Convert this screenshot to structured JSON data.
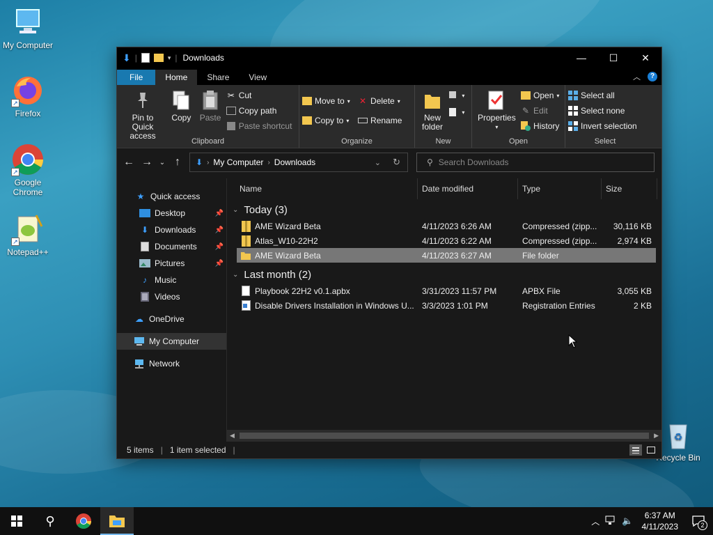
{
  "desktop": {
    "icons": [
      {
        "label": "My Computer",
        "icon": "computer-icon"
      },
      {
        "label": "Firefox",
        "icon": "firefox-icon"
      },
      {
        "label": "Google Chrome",
        "icon": "chrome-icon"
      },
      {
        "label": "Notepad++",
        "icon": "notepadpp-icon"
      },
      {
        "label": "Recycle Bin",
        "icon": "recycle-bin-icon"
      }
    ]
  },
  "window": {
    "title": "Downloads",
    "tabs": {
      "file": "File",
      "home": "Home",
      "share": "Share",
      "view": "View"
    },
    "ribbon": {
      "clipboard": {
        "label": "Clipboard",
        "pin": "Pin to Quick access",
        "copy": "Copy",
        "paste": "Paste",
        "cut": "Cut",
        "copy_path": "Copy path",
        "paste_shortcut": "Paste shortcut"
      },
      "organize": {
        "label": "Organize",
        "move_to": "Move to",
        "copy_to": "Copy to",
        "delete": "Delete",
        "rename": "Rename"
      },
      "new": {
        "label": "New",
        "new_folder": "New folder"
      },
      "open": {
        "label": "Open",
        "properties": "Properties",
        "open": "Open",
        "edit": "Edit",
        "history": "History"
      },
      "select": {
        "label": "Select",
        "select_all": "Select all",
        "select_none": "Select none",
        "invert": "Invert selection"
      }
    },
    "address": {
      "root": "My Computer",
      "current": "Downloads"
    },
    "search": {
      "placeholder": "Search Downloads"
    },
    "nav": {
      "quick_access": "Quick access",
      "desktop": "Desktop",
      "downloads": "Downloads",
      "documents": "Documents",
      "pictures": "Pictures",
      "music": "Music",
      "videos": "Videos",
      "onedrive": "OneDrive",
      "my_computer": "My Computer",
      "network": "Network"
    },
    "columns": {
      "name": "Name",
      "date": "Date modified",
      "type": "Type",
      "size": "Size"
    },
    "groups": [
      {
        "title": "Today (3)",
        "files": [
          {
            "name": "AME Wizard Beta",
            "date": "4/11/2023 6:26 AM",
            "type": "Compressed (zipp...",
            "size": "30,116 KB",
            "icon": "zip-folder-icon"
          },
          {
            "name": "Atlas_W10-22H2",
            "date": "4/11/2023 6:22 AM",
            "type": "Compressed (zipp...",
            "size": "2,974 KB",
            "icon": "zip-folder-icon"
          },
          {
            "name": "AME Wizard Beta",
            "date": "4/11/2023 6:27 AM",
            "type": "File folder",
            "size": "",
            "icon": "folder-icon"
          }
        ]
      },
      {
        "title": "Last month (2)",
        "files": [
          {
            "name": "Playbook 22H2 v0.1.apbx",
            "date": "3/31/2023 11:57 PM",
            "type": "APBX File",
            "size": "3,055 KB",
            "icon": "file-icon"
          },
          {
            "name": "Disable Drivers Installation in Windows U...",
            "date": "3/3/2023 1:01 PM",
            "type": "Registration Entries",
            "size": "2 KB",
            "icon": "registry-file-icon"
          }
        ]
      }
    ],
    "status": {
      "items": "5 items",
      "selected": "1 item selected"
    }
  },
  "taskbar": {
    "time": "6:37 AM",
    "date": "4/11/2023",
    "notifications": "2"
  },
  "colors": {
    "accent": "#1979b0",
    "selected_row": "#777777"
  }
}
